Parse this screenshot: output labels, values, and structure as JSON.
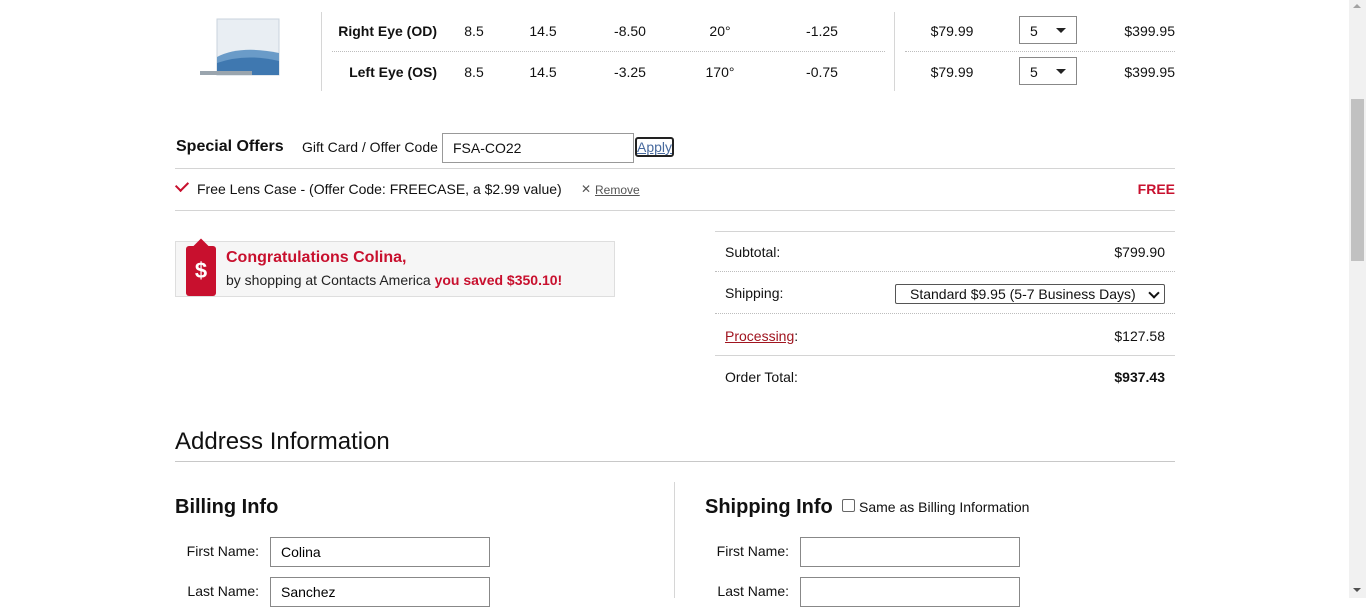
{
  "order_table": {
    "rows": [
      {
        "eye": "Right Eye (OD)",
        "bc": "8.5",
        "dia": "14.5",
        "power": "-8.50",
        "axis": "20°",
        "cyl": "-1.25",
        "price": "$79.99",
        "qty": "5",
        "total": "$399.95"
      },
      {
        "eye": "Left Eye (OS)",
        "bc": "8.5",
        "dia": "14.5",
        "power": "-3.25",
        "axis": "170°",
        "cyl": "-0.75",
        "price": "$79.99",
        "qty": "5",
        "total": "$399.95"
      }
    ]
  },
  "special_offers": {
    "title": "Special Offers",
    "code_label": "Gift Card / Offer Code",
    "code_value": "FSA-CO22",
    "apply_label": "Apply",
    "applied_offer": "Free Lens Case - (Offer Code: FREECASE, a $2.99 value)",
    "remove_label": "Remove",
    "offer_price": "FREE"
  },
  "savings": {
    "icon": "dollar-tag-icon",
    "headline": "Congratulations Colina,",
    "sub_prefix": "by shopping at Contacts America ",
    "sub_highlight": "you saved $350.10!"
  },
  "summary": {
    "subtotal_label": "Subtotal:",
    "subtotal_value": "$799.90",
    "shipping_label": "Shipping:",
    "shipping_option": "Standard $9.95 (5-7 Business Days)",
    "processing_label": "Processing",
    "processing_colon": ":",
    "processing_value": "$127.58",
    "total_label": "Order Total:",
    "total_value": "$937.43"
  },
  "address": {
    "title": "Address Information",
    "billing": {
      "title": "Billing Info",
      "first_label": "First Name:",
      "first_value": "Colina",
      "last_label": "Last Name:",
      "last_value": "Sanchez"
    },
    "shipping": {
      "title": "Shipping Info",
      "same_label": "Same as Billing Information",
      "first_label": "First Name:",
      "first_value": "",
      "last_label": "Last Name:",
      "last_value": ""
    }
  },
  "colors": {
    "accent": "#c8102e",
    "link": "#486a9e"
  }
}
